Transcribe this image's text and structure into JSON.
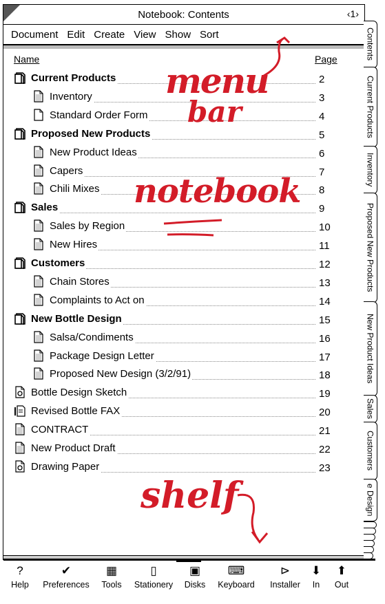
{
  "window": {
    "title": "Notebook: Contents",
    "page_indicator": "‹1›"
  },
  "menu": [
    "Document",
    "Edit",
    "Create",
    "View",
    "Show",
    "Sort"
  ],
  "columns": {
    "name": "Name",
    "page": "Page"
  },
  "rows": [
    {
      "name": "Current Products",
      "page": "2",
      "level": 0,
      "icon": "section-icon",
      "bold": true
    },
    {
      "name": "Inventory",
      "page": "3",
      "level": 1,
      "icon": "document-icon",
      "bold": false
    },
    {
      "name": "Standard Order Form",
      "page": "4",
      "level": 1,
      "icon": "blank-document-icon",
      "bold": false
    },
    {
      "name": "Proposed New Products",
      "page": "5",
      "level": 0,
      "icon": "section-icon",
      "bold": true
    },
    {
      "name": "New Product Ideas",
      "page": "6",
      "level": 1,
      "icon": "document-icon",
      "bold": false
    },
    {
      "name": "Capers",
      "page": "7",
      "level": 1,
      "icon": "document-icon",
      "bold": false
    },
    {
      "name": "Chili Mixes",
      "page": "8",
      "level": 1,
      "icon": "document-icon",
      "bold": false
    },
    {
      "name": "Sales",
      "page": "9",
      "level": 0,
      "icon": "section-icon",
      "bold": true
    },
    {
      "name": "Sales by Region",
      "page": "10",
      "level": 1,
      "icon": "document-icon",
      "bold": false
    },
    {
      "name": "New Hires",
      "page": "11",
      "level": 1,
      "icon": "document-icon",
      "bold": false
    },
    {
      "name": "Customers",
      "page": "12",
      "level": 0,
      "icon": "section-icon",
      "bold": true
    },
    {
      "name": "Chain Stores",
      "page": "13",
      "level": 1,
      "icon": "document-icon",
      "bold": false
    },
    {
      "name": "Complaints to Act on",
      "page": "14",
      "level": 1,
      "icon": "document-icon",
      "bold": false
    },
    {
      "name": "New Bottle Design",
      "page": "15",
      "level": 0,
      "icon": "section-icon",
      "bold": true
    },
    {
      "name": "Salsa/Condiments",
      "page": "16",
      "level": 1,
      "icon": "document-icon",
      "bold": false
    },
    {
      "name": "Package Design Letter",
      "page": "17",
      "level": 1,
      "icon": "document-icon",
      "bold": false
    },
    {
      "name": "Proposed New Design (3/2/91)",
      "page": "18",
      "level": 1,
      "icon": "document-icon",
      "bold": false
    },
    {
      "name": "Bottle Design Sketch",
      "page": "19",
      "level": 0,
      "icon": "drawing-icon",
      "bold": false
    },
    {
      "name": "Revised Bottle FAX",
      "page": "20",
      "level": 0,
      "icon": "fax-icon",
      "bold": false
    },
    {
      "name": "CONTRACT",
      "page": "21",
      "level": 0,
      "icon": "document-icon",
      "bold": false
    },
    {
      "name": "New Product Draft",
      "page": "22",
      "level": 0,
      "icon": "document-icon",
      "bold": false
    },
    {
      "name": "Drawing Paper",
      "page": "23",
      "level": 0,
      "icon": "drawing-icon",
      "bold": false
    }
  ],
  "tabs": [
    "Contents",
    "Current Products",
    "Inventory",
    "Proposed New Products",
    "New Product Ideas",
    "Sales",
    "Customers",
    "e Design"
  ],
  "bottom_buttons": [
    {
      "label": "Help",
      "icon": "help-icon",
      "glyph": "?"
    },
    {
      "label": "Preferences",
      "icon": "checkmark-icon",
      "glyph": "✔"
    },
    {
      "label": "Tools",
      "icon": "tools-icon",
      "glyph": "▦"
    },
    {
      "label": "Stationery",
      "icon": "stationery-icon",
      "glyph": "▯"
    },
    {
      "label": "Disks",
      "icon": "disk-icon",
      "glyph": "▣"
    },
    {
      "label": "Keyboard",
      "icon": "keyboard-icon",
      "glyph": "⌨"
    },
    {
      "label": "Installer",
      "icon": "installer-icon",
      "glyph": "⊳"
    },
    {
      "label": "In",
      "icon": "in-tray-icon",
      "glyph": "⬇"
    },
    {
      "label": "Out",
      "icon": "out-tray-icon",
      "glyph": "⬆"
    }
  ],
  "annotations": {
    "menu": "menu",
    "bar": "bar",
    "notebook": "notebook",
    "shelf": "shelf"
  },
  "colors": {
    "annotation": "#d31c28"
  }
}
